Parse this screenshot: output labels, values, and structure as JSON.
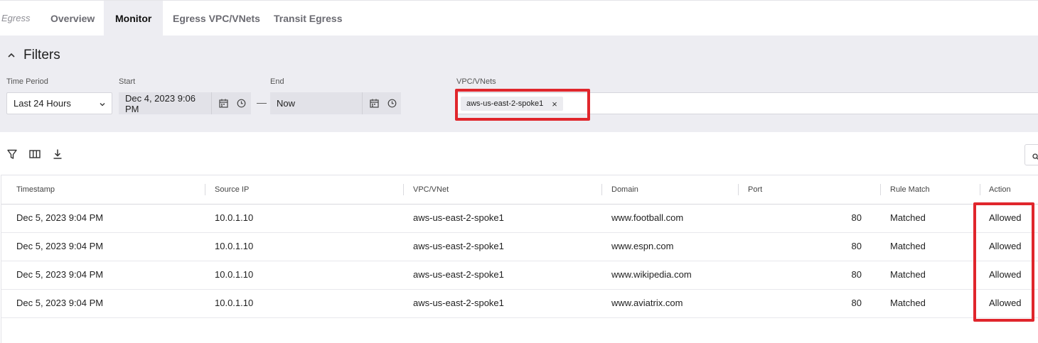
{
  "tabs": {
    "prefix": "Egress",
    "items": [
      {
        "label": "Overview"
      },
      {
        "label": "Monitor"
      },
      {
        "label": "Egress VPC/VNets"
      },
      {
        "label": "Transit Egress"
      }
    ],
    "active_index": 1
  },
  "filters": {
    "title": "Filters",
    "time_period": {
      "label": "Time Period",
      "value": "Last 24 Hours"
    },
    "start": {
      "label": "Start",
      "value": "Dec 4, 2023 9:06 PM"
    },
    "separator": "—",
    "end": {
      "label": "End",
      "value": "Now"
    },
    "vpc": {
      "label": "VPC/VNets",
      "chip": "aws-us-east-2-spoke1",
      "chip_remove": "×"
    }
  },
  "toolbar": {
    "icons": [
      "filter-icon",
      "columns-icon",
      "download-icon",
      "search-icon"
    ]
  },
  "table": {
    "columns": [
      "Timestamp",
      "Source IP",
      "VPC/VNet",
      "Domain",
      "Port",
      "Rule Match",
      "Action"
    ],
    "rows": [
      {
        "timestamp": "Dec 5, 2023 9:04 PM",
        "source_ip": "10.0.1.10",
        "vpc": "aws-us-east-2-spoke1",
        "domain": "www.football.com",
        "port": "80",
        "rule_match": "Matched",
        "action": "Allowed"
      },
      {
        "timestamp": "Dec 5, 2023 9:04 PM",
        "source_ip": "10.0.1.10",
        "vpc": "aws-us-east-2-spoke1",
        "domain": "www.espn.com",
        "port": "80",
        "rule_match": "Matched",
        "action": "Allowed"
      },
      {
        "timestamp": "Dec 5, 2023 9:04 PM",
        "source_ip": "10.0.1.10",
        "vpc": "aws-us-east-2-spoke1",
        "domain": "www.wikipedia.com",
        "port": "80",
        "rule_match": "Matched",
        "action": "Allowed"
      },
      {
        "timestamp": "Dec 5, 2023 9:04 PM",
        "source_ip": "10.0.1.10",
        "vpc": "aws-us-east-2-spoke1",
        "domain": "www.aviatrix.com",
        "port": "80",
        "rule_match": "Matched",
        "action": "Allowed"
      }
    ]
  },
  "colors": {
    "highlight": "#e0262c",
    "panel": "#ededf2",
    "active_tab": "#ededf2"
  }
}
